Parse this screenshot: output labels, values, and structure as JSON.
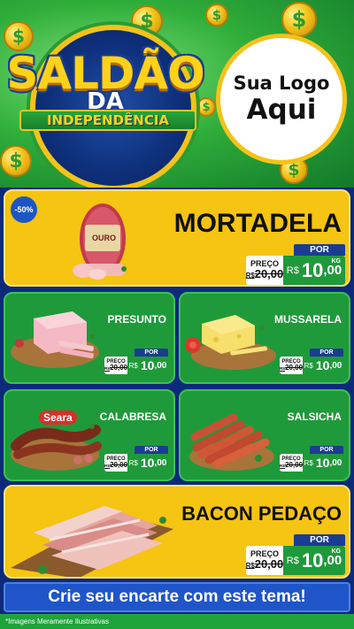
{
  "header": {
    "title_line1": "SALDÃO",
    "title_line2": "DA",
    "title_line3": "INDEPENDÊNCIA",
    "logo_line1": "Sua Logo",
    "logo_line2": "Aqui",
    "coin_glyph": "$"
  },
  "colors": {
    "yellow": "#f6c412",
    "green": "#1f9a3a",
    "blue": "#1a3d91",
    "background": "#0d2a7a"
  },
  "products": {
    "mortadela": {
      "name": "MORTADELA",
      "discount": "-50%",
      "label_ouro": "OURO",
      "por": "POR",
      "preco": "PREÇO",
      "old_prefix": "R$",
      "old_value": "20,00",
      "currency": "R$",
      "new_int": "10",
      "new_dec": ",00",
      "unit": "KG"
    },
    "presunto": {
      "name": "PRESUNTO",
      "por": "POR",
      "preco": "PREÇO",
      "old_prefix": "R$",
      "old_value": "20,00",
      "currency": "R$",
      "new_int": "10",
      "new_dec": ",00"
    },
    "mussarela": {
      "name": "MUSSARELA",
      "por": "POR",
      "preco": "PREÇO",
      "old_prefix": "R$",
      "old_value": "20,00",
      "currency": "R$",
      "new_int": "10",
      "new_dec": ",00"
    },
    "calabresa": {
      "name": "CALABRESA",
      "brand": "Seara",
      "por": "POR",
      "preco": "PREÇO",
      "old_prefix": "R$",
      "old_value": "20,00",
      "currency": "R$",
      "new_int": "10",
      "new_dec": ",00"
    },
    "salsicha": {
      "name": "SALSICHA",
      "por": "POR",
      "preco": "PREÇO",
      "old_prefix": "R$",
      "old_value": "20,00",
      "currency": "R$",
      "new_int": "10",
      "new_dec": ",00"
    },
    "bacon": {
      "name": "BACON PEDAÇO",
      "por": "POR",
      "preco": "PREÇO",
      "old_prefix": "R$",
      "old_value": "20,00",
      "currency": "R$",
      "new_int": "10",
      "new_dec": ",00",
      "unit": "KG"
    }
  },
  "cta": {
    "label": "Crie seu encarte com este tema!"
  },
  "footer": {
    "disclaimer": "*Imagens Meramente Ilustrativas"
  }
}
